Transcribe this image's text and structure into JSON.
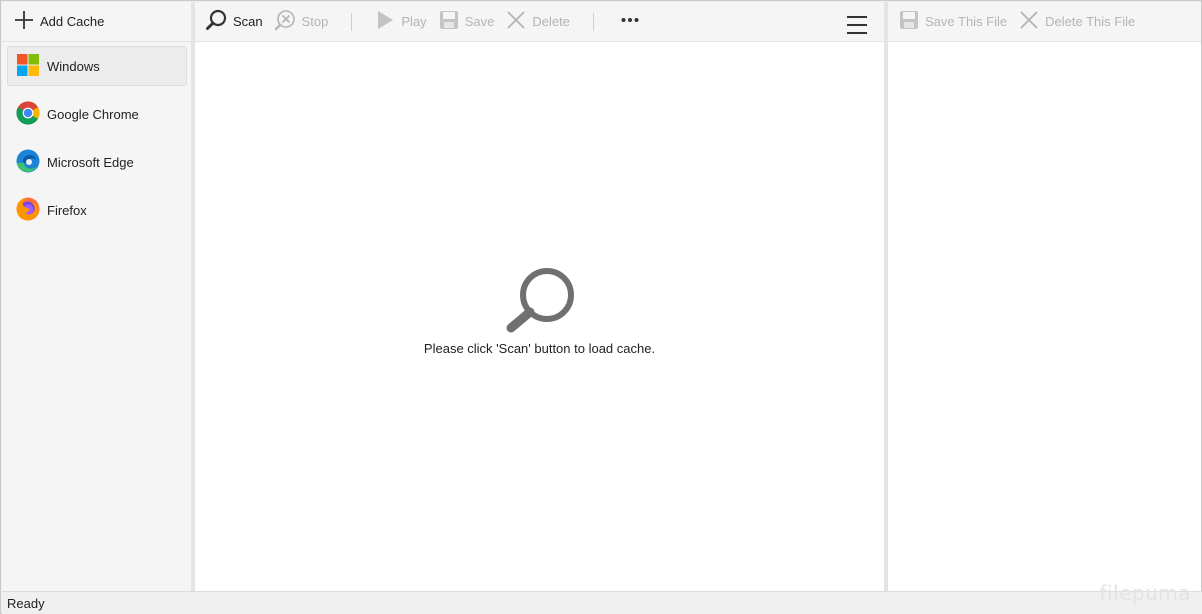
{
  "left_toolbar": {
    "add_cache_label": "Add Cache"
  },
  "browsers": [
    {
      "label": "Windows",
      "icon": "windows-icon",
      "selected": true
    },
    {
      "label": "Google Chrome",
      "icon": "chrome-icon",
      "selected": false
    },
    {
      "label": "Microsoft Edge",
      "icon": "edge-icon",
      "selected": false
    },
    {
      "label": "Firefox",
      "icon": "firefox-icon",
      "selected": false
    }
  ],
  "main_toolbar": {
    "scan_label": "Scan",
    "stop_label": "Stop",
    "play_label": "Play",
    "save_label": "Save",
    "delete_label": "Delete"
  },
  "main": {
    "empty_message": "Please click 'Scan' button to load cache."
  },
  "detail_toolbar": {
    "save_file_label": "Save This File",
    "delete_file_label": "Delete This File"
  },
  "status": {
    "text": "Ready"
  },
  "watermark": {
    "text": "filepuma"
  },
  "colors": {
    "enabled_text": "#222222",
    "disabled_text": "#b4b4b4",
    "selected_item_bg": "#ececec"
  }
}
